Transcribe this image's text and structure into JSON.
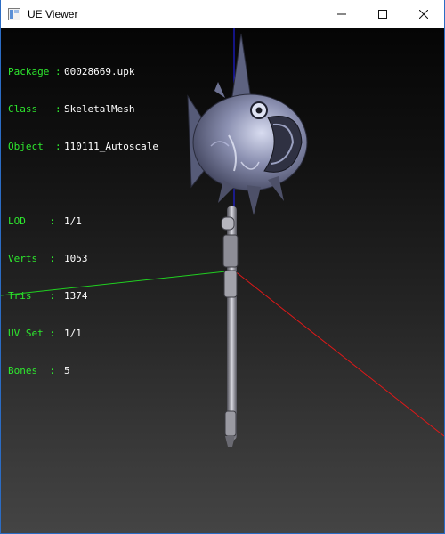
{
  "window": {
    "title": "UE Viewer",
    "controls": [
      "minimize",
      "maximize",
      "close"
    ]
  },
  "info": {
    "object_lines": [
      {
        "key": "Package",
        "sep": " : ",
        "value": "00028669.upk"
      },
      {
        "key": "Class",
        "sep": "   : ",
        "value": "SkeletalMesh"
      },
      {
        "key": "Object",
        "sep": "  : ",
        "value": "110111_Autoscale"
      }
    ],
    "mesh_lines": [
      {
        "key": "LOD",
        "sep": "    : ",
        "value": "1/1"
      },
      {
        "key": "Verts",
        "sep": "  : ",
        "value": "1053"
      },
      {
        "key": "Tris",
        "sep": "   : ",
        "value": "1374"
      },
      {
        "key": "UV Set",
        "sep": " : ",
        "value": "1/1"
      },
      {
        "key": "Bones",
        "sep": "  : ",
        "value": "5"
      }
    ]
  },
  "colors": {
    "label": "#2ee82e",
    "value": "#ffffff",
    "axis_x": "#ff2020",
    "axis_y": "#20d020",
    "axis_z": "#2020ff"
  },
  "icons": {
    "app": "ue-viewer-app-icon",
    "minimize": "minimize-icon",
    "maximize": "maximize-icon",
    "close": "close-icon"
  }
}
